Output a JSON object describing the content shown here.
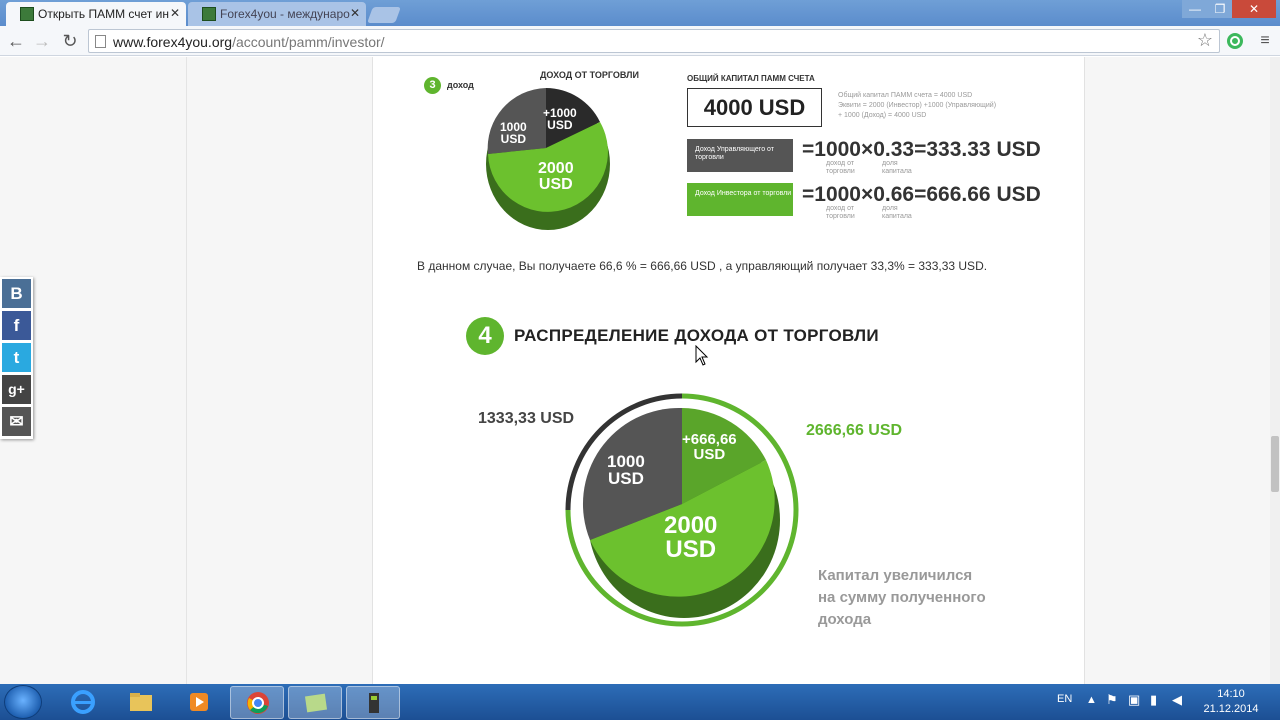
{
  "browser": {
    "tabs": [
      {
        "title": "Открыть ПАММ счет ин",
        "active": true
      },
      {
        "title": "Forex4you - междунаро",
        "active": false
      }
    ],
    "url_host": "www.forex4you.org",
    "url_path": "/account/pamm/investor/",
    "window_buttons": [
      "—",
      "❐",
      "✕"
    ]
  },
  "share_bar": {
    "items": [
      {
        "icon": "vk-icon",
        "glyph": "B"
      },
      {
        "icon": "facebook-icon",
        "glyph": "f"
      },
      {
        "icon": "twitter-icon",
        "glyph": "t"
      },
      {
        "icon": "google-plus-icon",
        "glyph": "g+"
      },
      {
        "icon": "mail-icon",
        "glyph": "✉"
      }
    ]
  },
  "section3": {
    "badge": "3",
    "label": "доход",
    "pie_title": "ДОХОД ОТ ТОРГОВЛИ",
    "pie": {
      "gray": "1000\nUSD",
      "dark": "+1000\nUSD",
      "green": "2000\nUSD"
    },
    "capital_title": "ОБЩИЙ КАПИТАЛ ПАММ СЧЕТА",
    "capital_value": "4000 USD",
    "capital_note_1": "Общий капитал ПАММ счета = 4000 USD",
    "capital_note_2": "Эквити = 2000 (Инвестор) +1000 (Управляющий)",
    "capital_note_3": "+ 1000 (Доход) = 4000 USD",
    "manager_label": "Доход Управляющего от торговли",
    "manager_formula": "=1000×0.33=333.33 USD",
    "investor_label": "Доход Инвестора от торговли",
    "investor_formula": "=1000×0.66=666.66 USD",
    "sub1": "доход от торговли",
    "sub2": "доля капитала"
  },
  "paragraph": "В данном случае, Вы получаете 66,6 % = 666,66 USD , а управляющий получает 33,3% = 333,33 USD.",
  "section4": {
    "badge": "4",
    "title": "РАСПРЕДЕЛЕНИЕ ДОХОДА ОТ ТОРГОВЛИ",
    "left_value": "1333,33 USD",
    "right_value": "2666,66 USD",
    "pie": {
      "gray": "1000\nUSD",
      "green_small": "+666,66\nUSD",
      "green": "2000\nUSD"
    },
    "note_line1": "Капитал увеличился",
    "note_line2": "на сумму полученного",
    "note_line3": "дохода"
  },
  "taskbar": {
    "lang": "EN",
    "time": "14:10",
    "date": "21.12.2014"
  },
  "colors": {
    "green": "#5fb52e",
    "dark": "#333333",
    "gray": "#6b6b6b"
  }
}
